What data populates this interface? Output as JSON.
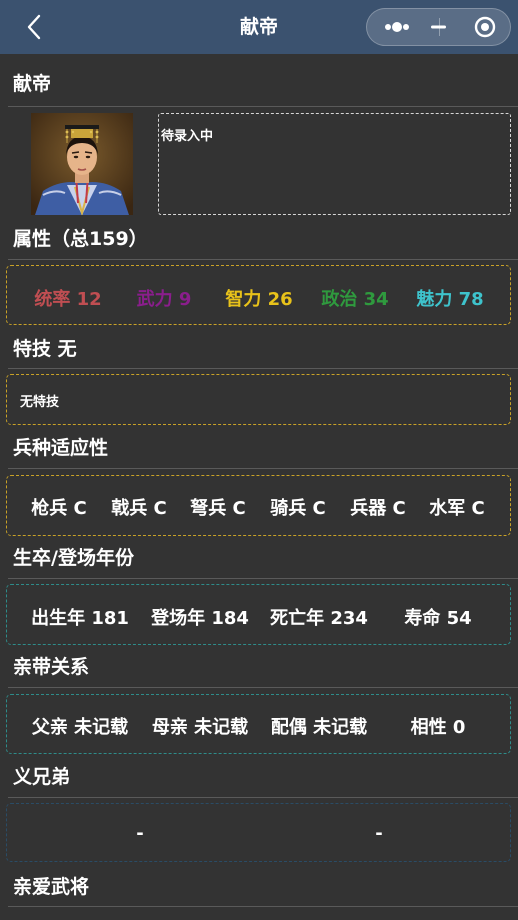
{
  "header": {
    "title": "献帝",
    "back_icon": "chevron-left-icon",
    "capsule_icons": [
      "more-dots-icon",
      "minimize-icon",
      "close-target-icon"
    ]
  },
  "name_heading": "献帝",
  "bio_text": "待录入中",
  "attributes": {
    "heading": "属性（总159）",
    "items": [
      {
        "label": "统率 12",
        "color": "#c04e52"
      },
      {
        "label": "武力 9",
        "color": "#8a1e8c"
      },
      {
        "label": "智力 26",
        "color": "#e8c21a"
      },
      {
        "label": "政治 34",
        "color": "#2f9a3e"
      },
      {
        "label": "魅力 78",
        "color": "#3ec3cc"
      }
    ]
  },
  "skill": {
    "heading": "特技 无",
    "text": "无特技"
  },
  "troops": {
    "heading": "兵种适应性",
    "items": [
      "枪兵 C",
      "戟兵 C",
      "弩兵 C",
      "骑兵 C",
      "兵器 C",
      "水军 C"
    ]
  },
  "years": {
    "heading": "生卒/登场年份",
    "items": [
      "出生年 181",
      "登场年 184",
      "死亡年 234",
      "寿命 54"
    ]
  },
  "relations": {
    "heading": "亲带关系",
    "items": [
      "父亲 未记载",
      "母亲 未记载",
      "配偶 未记载",
      "相性 0"
    ]
  },
  "sworn": {
    "heading": "义兄弟",
    "items": [
      "-",
      "-"
    ]
  },
  "favorite": {
    "heading": "亲爱武将"
  }
}
